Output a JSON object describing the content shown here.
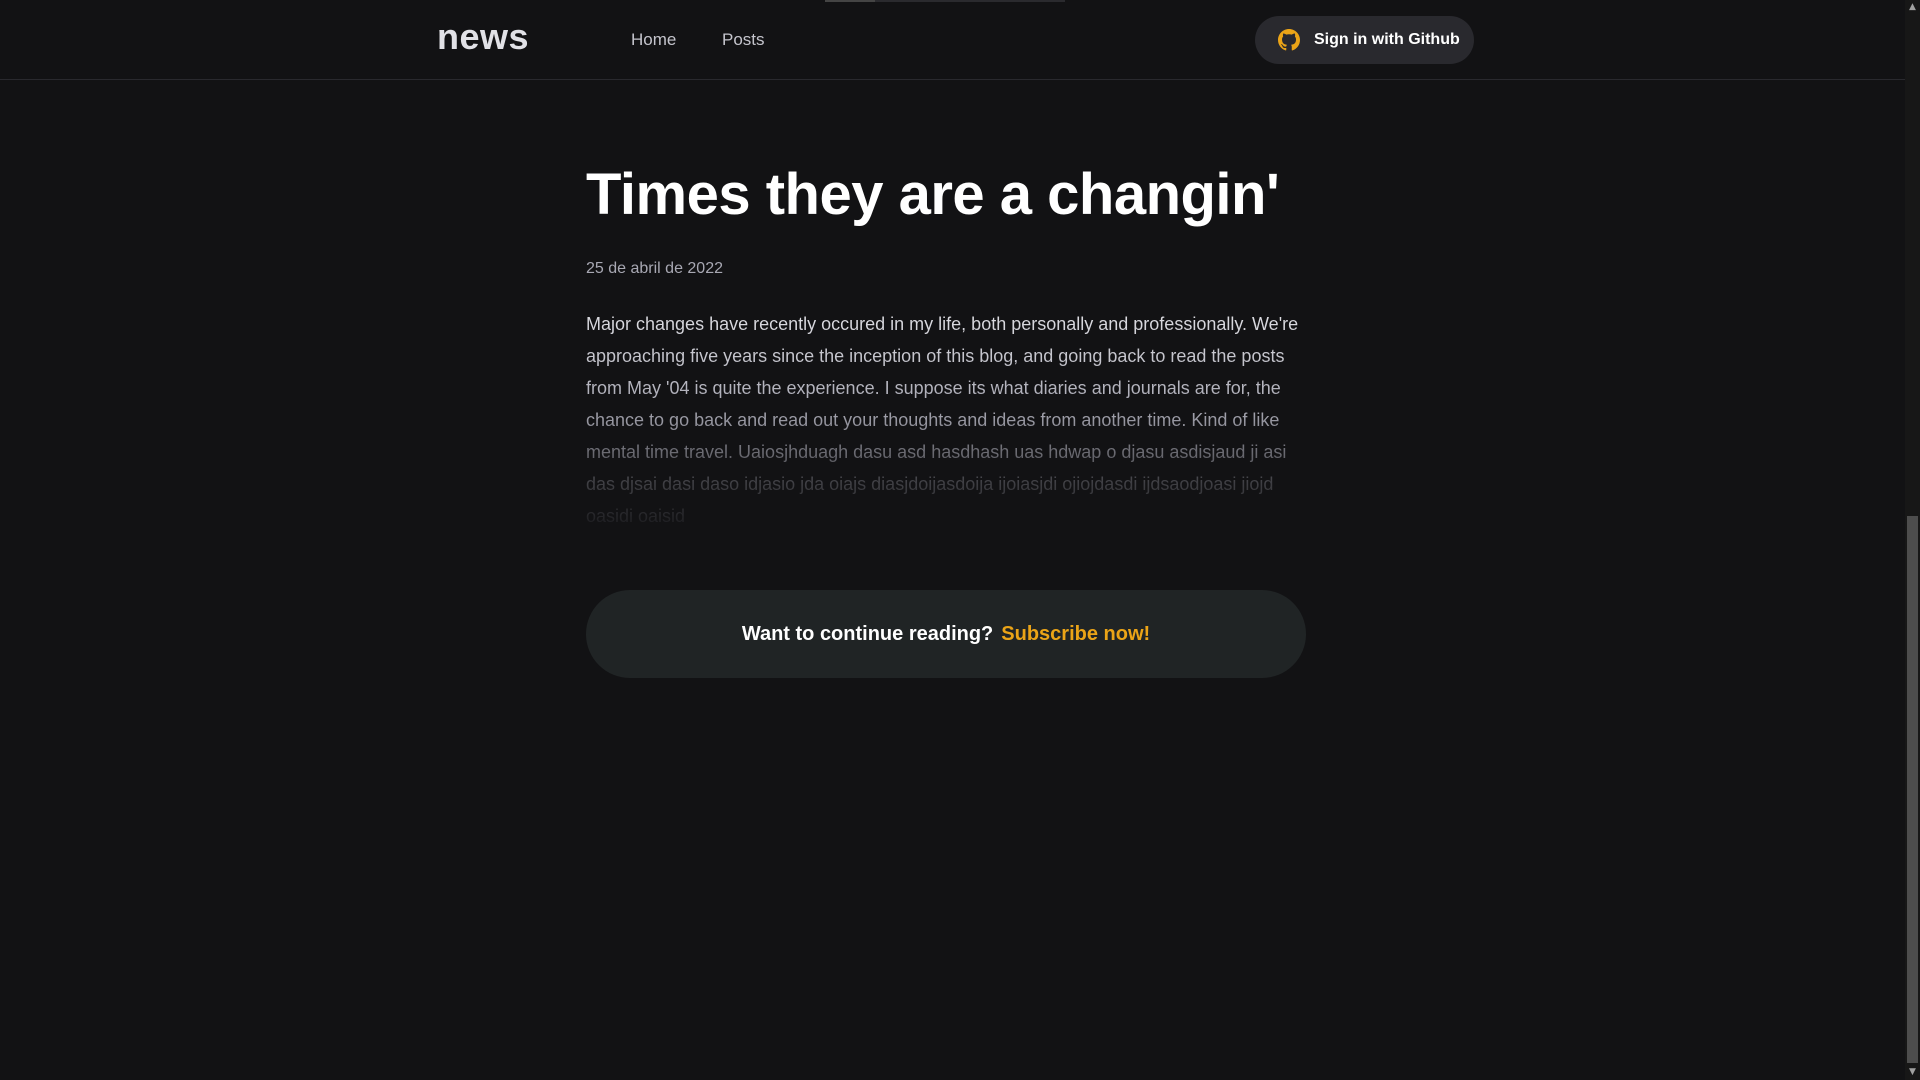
{
  "header": {
    "logo": "news",
    "nav": [
      {
        "label": "Home"
      },
      {
        "label": "Posts"
      }
    ],
    "signin_label": "Sign in with Github",
    "signin_icon": "github-icon",
    "signin_icon_color": "#eba417"
  },
  "article": {
    "title": "Times they are a changin'",
    "date": "25 de abril de 2022",
    "content": "Major changes have recently occured in my life, both personally and professionally. We're approaching five years since the inception of this blog, and going back to read the posts from May '04 is quite the experience. I suppose its what diaries and journals are for, the chance to go back and read out your thoughts and ideas from another time. Kind of like mental time travel. Uaiosjhduagh dasu asd hasdhash uas hdwap o djasu asdisjaud ji asi das djsai dasi daso idjasio jda oiajs diasjdoijasdoija ijoiasjdi ojiojdasdi ijdsaodjoasi jiojd oasidi oaisid"
  },
  "continue_reading": {
    "prompt": "Want to continue reading?",
    "subscribe_label": "Subscribe now!",
    "accent_color": "#eba417"
  },
  "scrollbar": {
    "up_icon": "scroll-up-arrow-icon",
    "down_icon": "scroll-down-arrow-icon"
  }
}
